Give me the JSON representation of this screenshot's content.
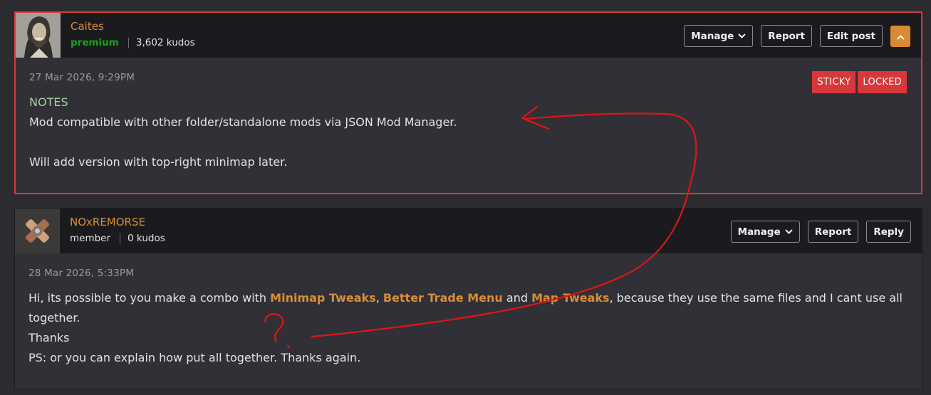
{
  "posts": [
    {
      "author": "Caites",
      "role": "premium",
      "kudos": "3,602 kudos",
      "buttons": {
        "manage": "Manage",
        "report": "Report",
        "edit": "Edit post"
      },
      "date": "27 Mar 2026, 9:29PM",
      "badges": [
        "STICKY",
        "LOCKED"
      ],
      "body": {
        "title": "NOTES",
        "line1": "Mod compatible with other folder/standalone mods via JSON Mod Manager.",
        "line2": "Will add version with top-right minimap later."
      }
    },
    {
      "author": "NOxREMORSE",
      "role": "member",
      "kudos": "0 kudos",
      "buttons": {
        "manage": "Manage",
        "report": "Report",
        "reply": "Reply"
      },
      "date": "28 Mar 2026, 5:33PM",
      "body": {
        "p1_a": "Hi, its possible to you make a combo with ",
        "link1": "Minimap Tweaks",
        "p1_b": ", ",
        "link2": "Better Trade Menu",
        "p1_c": " and ",
        "link3": "Map Tweaks",
        "p1_d": ", because they use the same files and I cant use all together.",
        "line2": "Thanks",
        "line3": "PS: or you can explain how put all together. Thanks again."
      }
    }
  ],
  "icons": {
    "manage_dropdown": "chevron-down-icon",
    "collapse": "chevron-up-icon"
  },
  "colors": {
    "accent": "#da8e35",
    "premium": "#1ca01c",
    "badge": "#d9383a",
    "annotation": "#e01515"
  }
}
